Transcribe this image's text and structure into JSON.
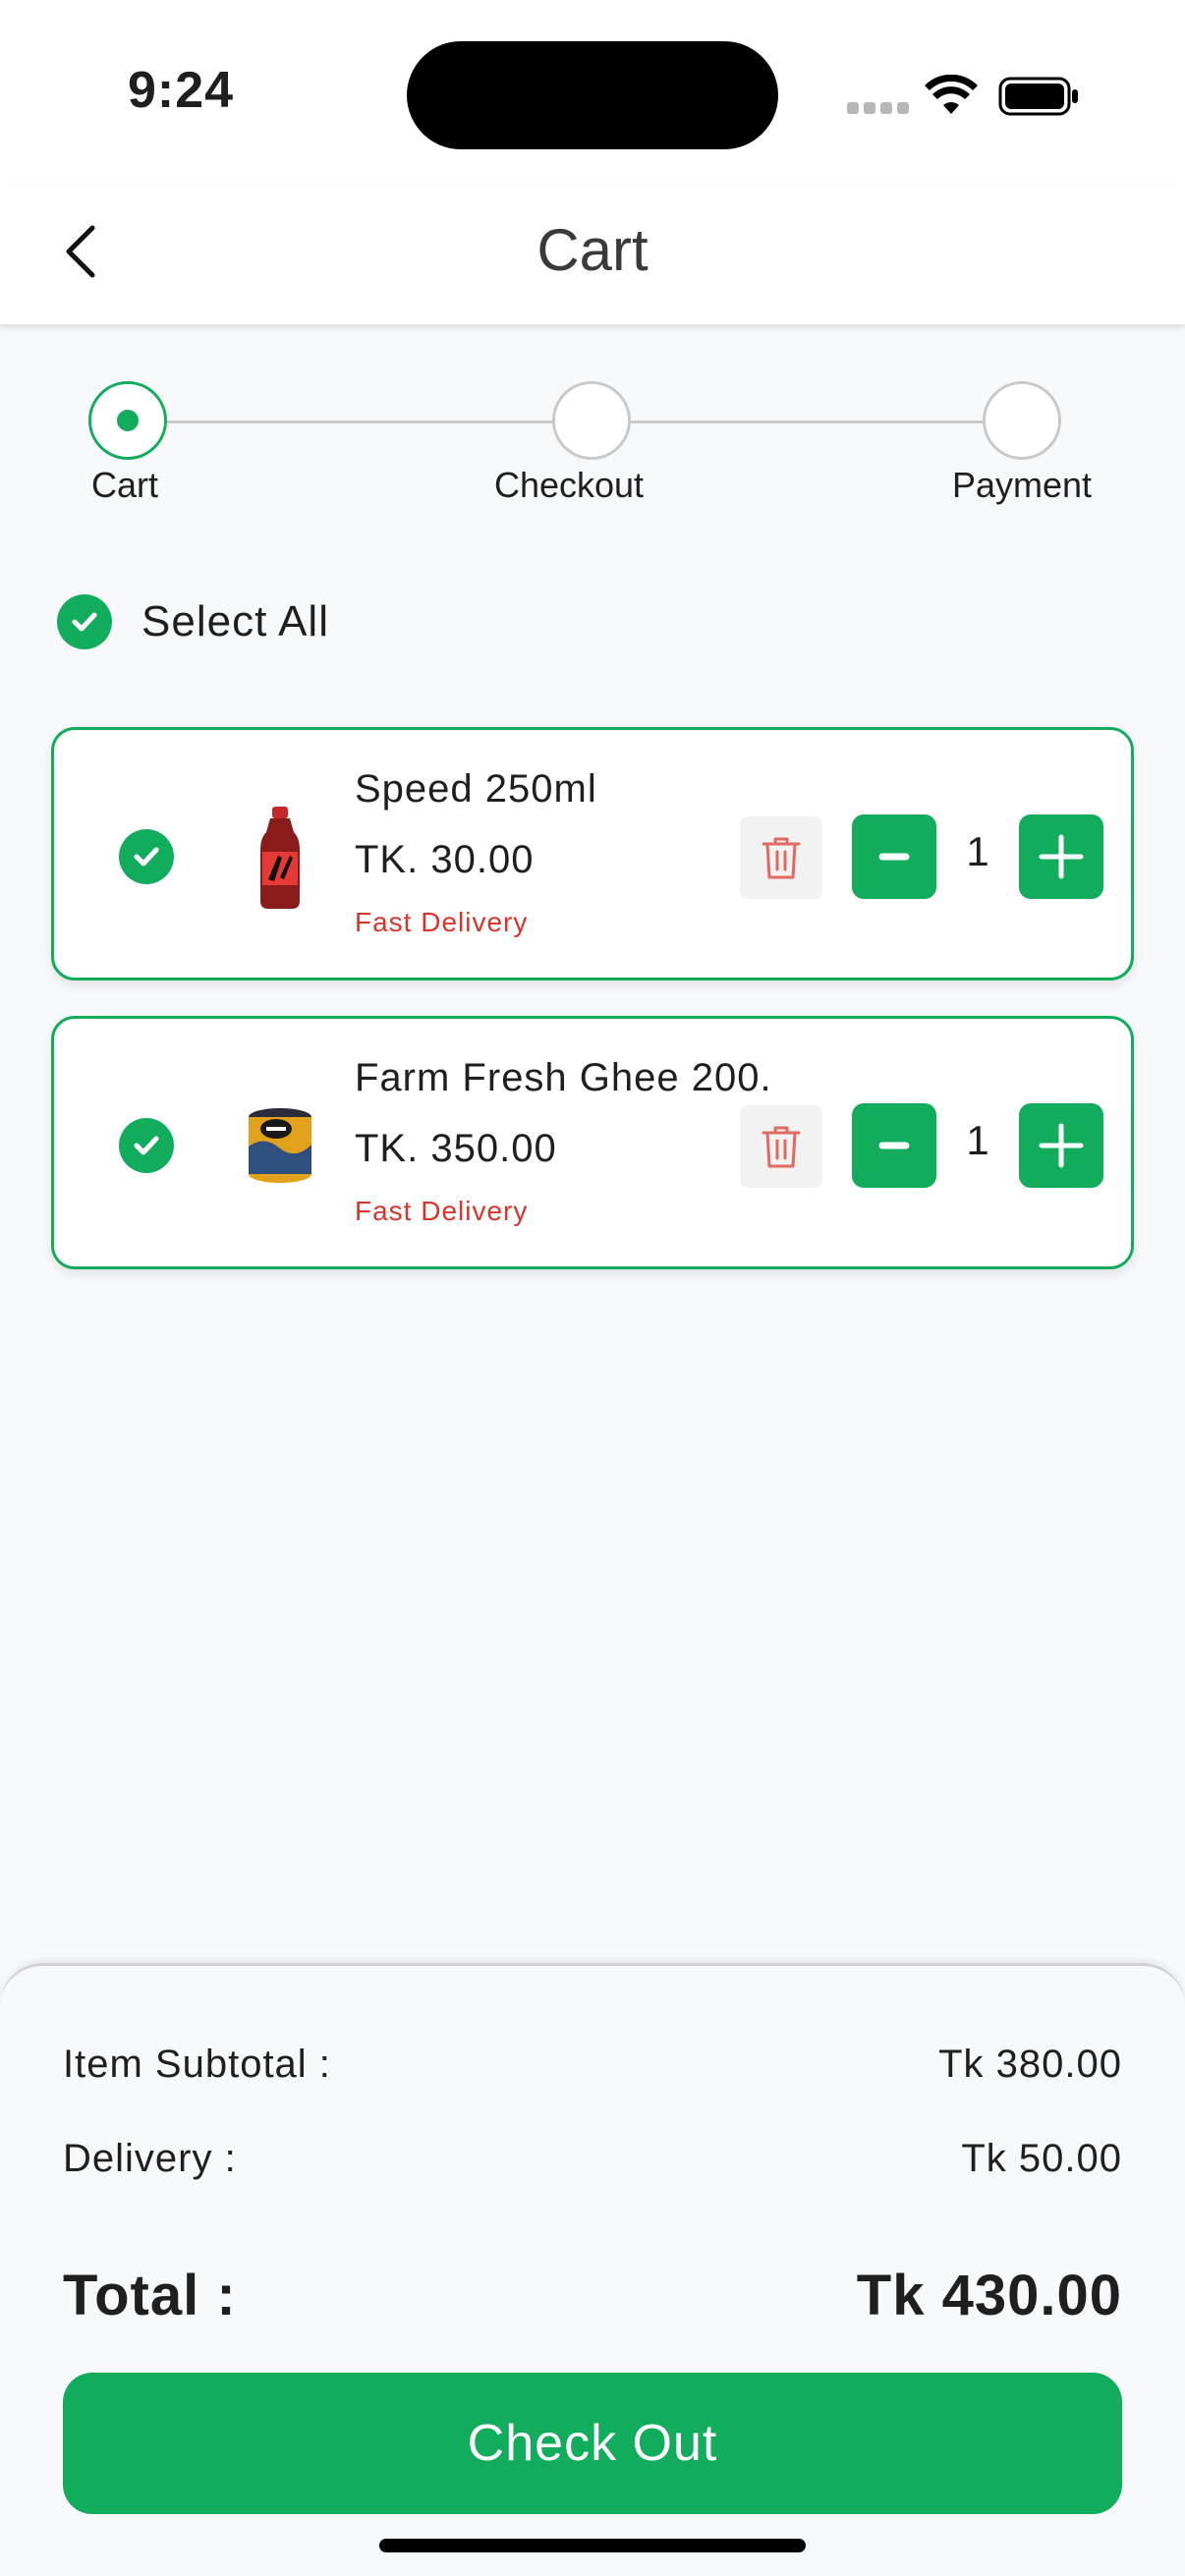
{
  "status_bar": {
    "time": "9:24"
  },
  "header": {
    "title": "Cart",
    "back_icon": "chevron-left-icon"
  },
  "stepper": {
    "steps": [
      {
        "label": "Cart",
        "active": true
      },
      {
        "label": "Checkout",
        "active": false
      },
      {
        "label": "Payment",
        "active": false
      }
    ]
  },
  "select_all": {
    "label": "Select All",
    "checked": true
  },
  "cart_items": [
    {
      "name": "Speed 250ml",
      "price": "TK. 30.00",
      "tag": "Fast Delivery",
      "quantity": "1",
      "checked": true,
      "thumb_icon": "soda-bottle-icon"
    },
    {
      "name": "Farm Fresh Ghee 200...",
      "price": "TK. 350.00",
      "tag": "Fast Delivery",
      "quantity": "1",
      "checked": true,
      "thumb_icon": "ghee-tin-icon"
    }
  ],
  "summary": {
    "subtotal_label": "Item Subtotal :",
    "subtotal_value": "Tk 380.00",
    "delivery_label": "Delivery :",
    "delivery_value": "Tk 50.00",
    "total_label": "Total :",
    "total_value": "Tk 430.00"
  },
  "checkout_button": {
    "label": "Check Out"
  },
  "colors": {
    "accent": "#11ad5c",
    "danger": "#d9342b",
    "background": "#f7f8fa"
  }
}
